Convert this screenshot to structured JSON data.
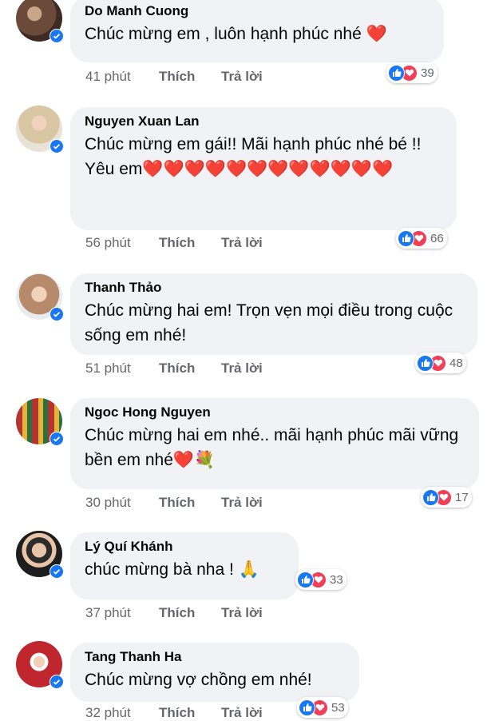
{
  "labels": {
    "like": "Thích",
    "reply": "Trả lời"
  },
  "comments": [
    {
      "name": "Do Manh Cuong",
      "text": "Chúc mừng em , luôn hạnh phúc nhé ❤️",
      "time": "41 phút",
      "reactions": "39",
      "avatar_color": "#6b4a3a"
    },
    {
      "name": "Nguyen Xuan Lan",
      "text": "Chúc mừng em gái!! Mãi hạnh phúc nhé bé !! Yêu em❤️❤️❤️❤️❤️❤️❤️❤️❤️❤️❤️❤️",
      "time": "56 phút",
      "reactions": "66",
      "avatar_color": "#d9c7a3"
    },
    {
      "name": "Thanh Thảo",
      "text": "Chúc mừng hai em! Trọn vẹn mọi điều trong cuộc sống em nhé!",
      "time": "51 phút",
      "reactions": "48",
      "avatar_color": "#b78a6c"
    },
    {
      "name": "Ngoc Hong Nguyen",
      "text": "Chúc mừng hai em nhé.. mãi hạnh phúc mãi vững bền em nhé❤️💐",
      "time": "30 phút",
      "reactions": "17",
      "avatar_color": "#b3342e"
    },
    {
      "name": "Lý Quí Khánh",
      "text": "chúc mừng bà nha ! 🙏",
      "time": "37 phút",
      "reactions": "33",
      "avatar_color": "#2b2b2b"
    },
    {
      "name": "Tang Thanh Ha",
      "text": "Chúc mừng vợ chồng em nhé!",
      "time": "32 phút",
      "reactions": "53",
      "avatar_color": "#c0262d"
    }
  ]
}
